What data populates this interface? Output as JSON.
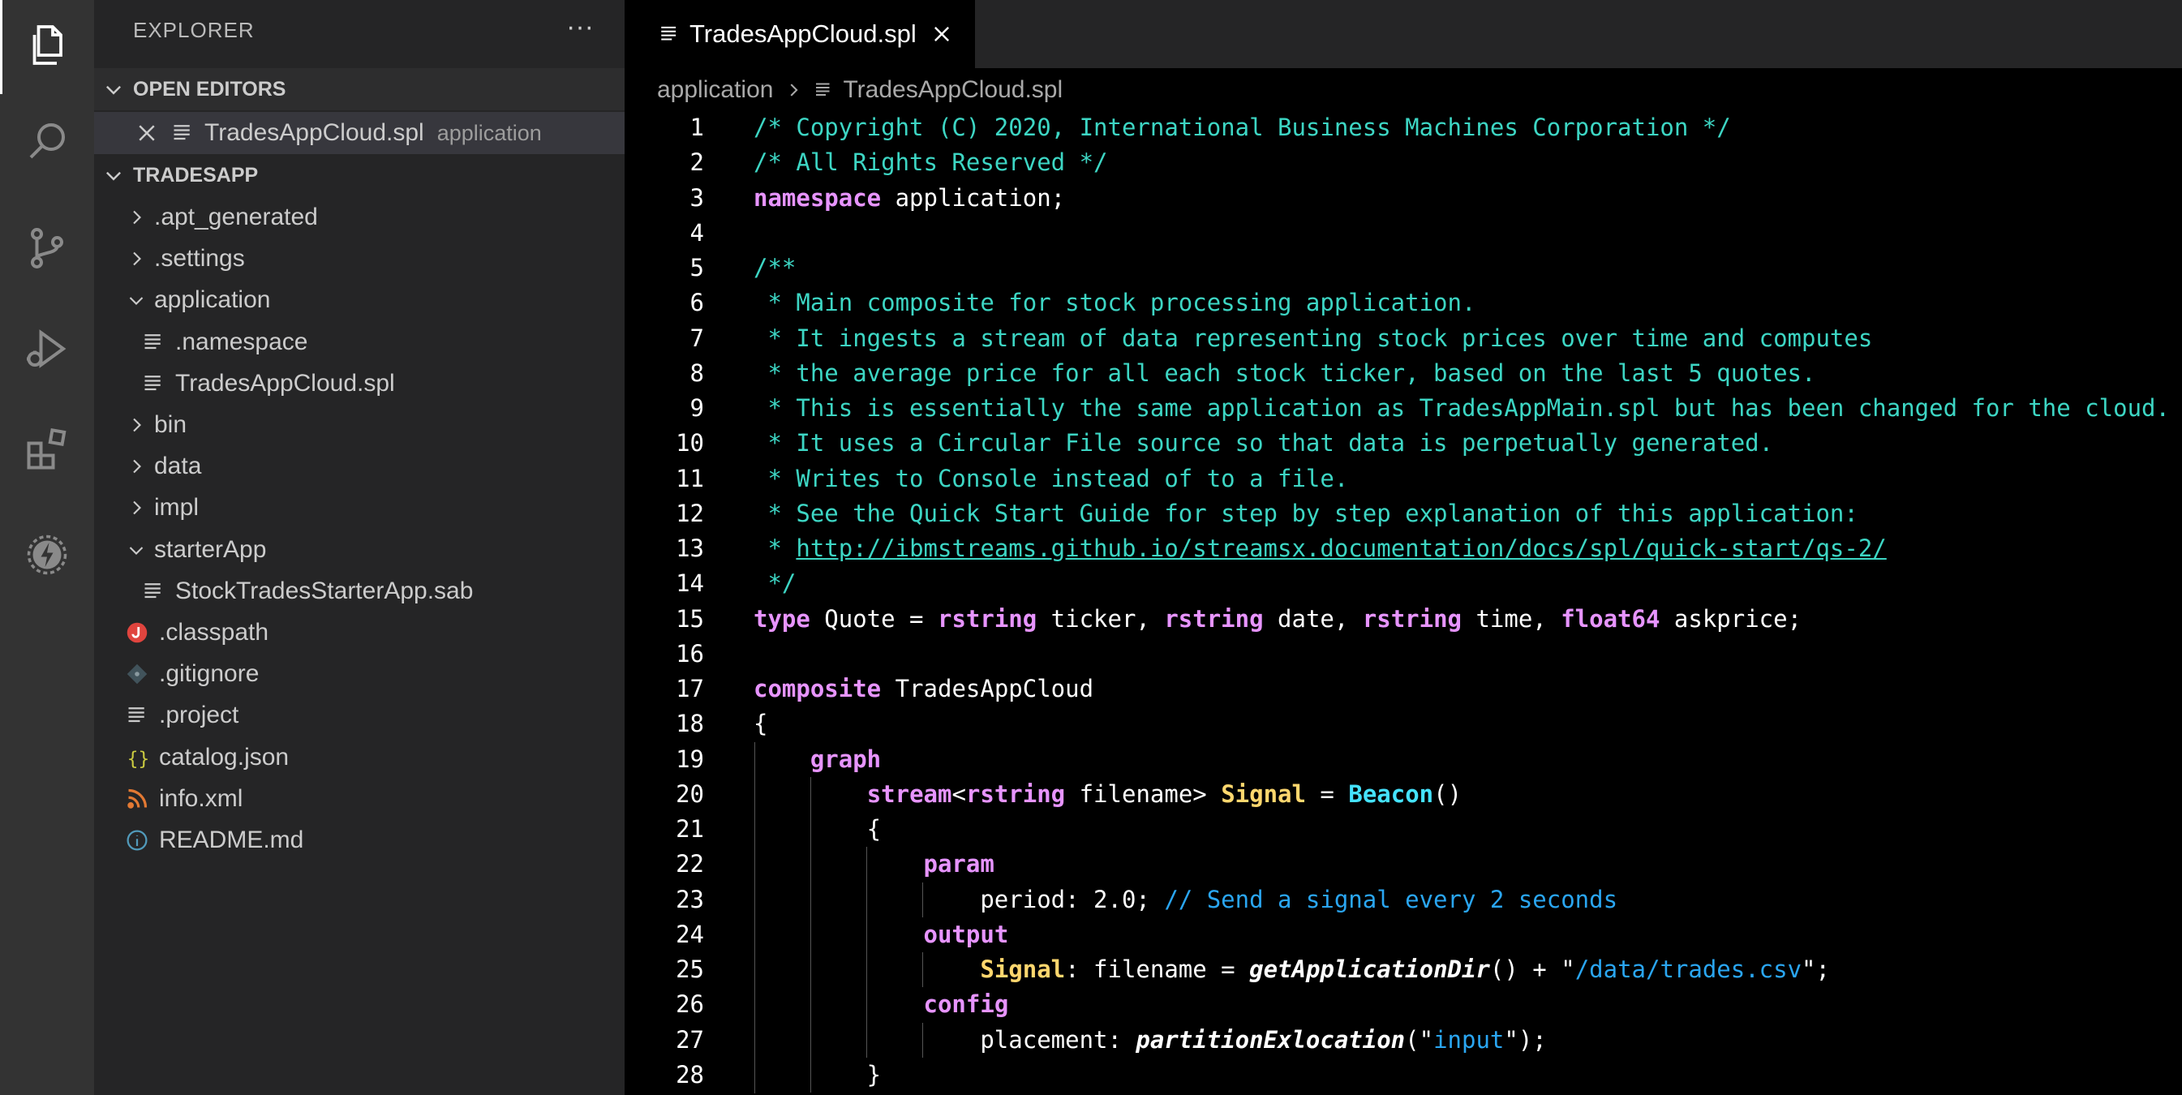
{
  "sidebar": {
    "title": "EXPLORER",
    "more_label": "···",
    "open_editors_label": "OPEN EDITORS",
    "open_editor": {
      "name": "TradesAppCloud.spl",
      "folder": "application"
    },
    "project_label": "TRADESAPP",
    "tree": [
      {
        "label": ".apt_generated",
        "kind": "folder",
        "expanded": false,
        "depth": 0
      },
      {
        "label": ".settings",
        "kind": "folder",
        "expanded": false,
        "depth": 0
      },
      {
        "label": "application",
        "kind": "folder",
        "expanded": true,
        "depth": 0
      },
      {
        "label": ".namespace",
        "kind": "file-lines",
        "depth": 1
      },
      {
        "label": "TradesAppCloud.spl",
        "kind": "file-lines",
        "depth": 1
      },
      {
        "label": "bin",
        "kind": "folder",
        "expanded": false,
        "depth": 0
      },
      {
        "label": "data",
        "kind": "folder",
        "expanded": false,
        "depth": 0
      },
      {
        "label": "impl",
        "kind": "folder",
        "expanded": false,
        "depth": 0
      },
      {
        "label": "starterApp",
        "kind": "folder",
        "expanded": true,
        "depth": 0
      },
      {
        "label": "StockTradesStarterApp.sab",
        "kind": "file-lines",
        "depth": 1
      },
      {
        "label": ".classpath",
        "kind": "java",
        "depth": 0
      },
      {
        "label": ".gitignore",
        "kind": "git",
        "depth": 0
      },
      {
        "label": ".project",
        "kind": "file-lines",
        "depth": 0
      },
      {
        "label": "catalog.json",
        "kind": "json",
        "depth": 0
      },
      {
        "label": "info.xml",
        "kind": "rss",
        "depth": 0
      },
      {
        "label": "README.md",
        "kind": "info",
        "depth": 0
      }
    ]
  },
  "editor": {
    "tab_label": "TradesAppCloud.spl",
    "breadcrumb": [
      "application",
      "TradesAppCloud.spl"
    ],
    "lines": [
      [
        [
          "c-com",
          "/* Copyright (C) 2020, International Business Machines Corporation */"
        ]
      ],
      [
        [
          "c-com",
          "/* All Rights Reserved */"
        ]
      ],
      [
        [
          "c-kw",
          "namespace"
        ],
        [
          "c-id",
          " application;"
        ]
      ],
      [],
      [
        [
          "c-com",
          "/**"
        ]
      ],
      [
        [
          "c-com",
          " * Main composite for stock processing application."
        ]
      ],
      [
        [
          "c-com",
          " * It ingests a stream of data representing stock prices over time and computes"
        ]
      ],
      [
        [
          "c-com",
          " * the average price for all each stock ticker, based on the last 5 quotes."
        ]
      ],
      [
        [
          "c-com",
          " * This is essentially the same application as TradesAppMain.spl but has been changed for the cloud."
        ]
      ],
      [
        [
          "c-com",
          " * It uses a Circular File source so that data is perpetually generated."
        ]
      ],
      [
        [
          "c-com",
          " * Writes to Console instead of to a file."
        ]
      ],
      [
        [
          "c-com",
          " * See the Quick Start Guide for step by step explanation of this application:"
        ]
      ],
      [
        [
          "c-com",
          " * "
        ],
        [
          "c-link",
          "http://ibmstreams.github.io/streamsx.documentation/docs/spl/quick-start/qs-2/"
        ]
      ],
      [
        [
          "c-com",
          " */"
        ]
      ],
      [
        [
          "c-kw",
          "type"
        ],
        [
          "c-id",
          " Quote = "
        ],
        [
          "c-ty",
          "rstring"
        ],
        [
          "c-id",
          " ticker, "
        ],
        [
          "c-ty",
          "rstring"
        ],
        [
          "c-id",
          " date, "
        ],
        [
          "c-ty",
          "rstring"
        ],
        [
          "c-id",
          " time, "
        ],
        [
          "c-ty",
          "float64"
        ],
        [
          "c-id",
          " askprice;"
        ]
      ],
      [],
      [
        [
          "c-kw",
          "composite"
        ],
        [
          "c-id",
          " TradesAppCloud"
        ]
      ],
      [
        [
          "c-id",
          "{"
        ]
      ],
      [
        [
          "c-id",
          "    "
        ],
        [
          "c-kw",
          "graph"
        ]
      ],
      [
        [
          "c-id",
          "        "
        ],
        [
          "c-kw",
          "stream"
        ],
        [
          "c-id",
          "<"
        ],
        [
          "c-ty",
          "rstring"
        ],
        [
          "c-id",
          " filename> "
        ],
        [
          "c-yel",
          "Signal"
        ],
        [
          "c-id",
          " = "
        ],
        [
          "c-cyan",
          "Beacon"
        ],
        [
          "c-id",
          "()"
        ]
      ],
      [
        [
          "c-id",
          "        {"
        ]
      ],
      [
        [
          "c-id",
          "            "
        ],
        [
          "c-kw",
          "param"
        ]
      ],
      [
        [
          "c-id",
          "                period: 2.0; "
        ],
        [
          "c-str",
          "// Send a signal every 2 seconds"
        ]
      ],
      [
        [
          "c-id",
          "            "
        ],
        [
          "c-kw",
          "output"
        ]
      ],
      [
        [
          "c-id",
          "                "
        ],
        [
          "c-yel",
          "Signal"
        ],
        [
          "c-id",
          ": filename = "
        ],
        [
          "c-fn",
          "getApplicationDir"
        ],
        [
          "c-id",
          "() + \""
        ],
        [
          "c-str",
          "/data/trades.csv"
        ],
        [
          "c-id",
          "\";"
        ]
      ],
      [
        [
          "c-id",
          "            "
        ],
        [
          "c-kw",
          "config"
        ]
      ],
      [
        [
          "c-id",
          "                placement: "
        ],
        [
          "c-fn",
          "partitionExlocation"
        ],
        [
          "c-id",
          "(\""
        ],
        [
          "c-str",
          "input"
        ],
        [
          "c-id",
          "\");"
        ]
      ],
      [
        [
          "c-id",
          "        }"
        ]
      ]
    ]
  },
  "colors": {
    "comment": "#3dd6c4",
    "keyword": "#e794ff",
    "string": "#2aa6f2",
    "class": "#ffd76e",
    "operator_name": "#45e3ff"
  }
}
